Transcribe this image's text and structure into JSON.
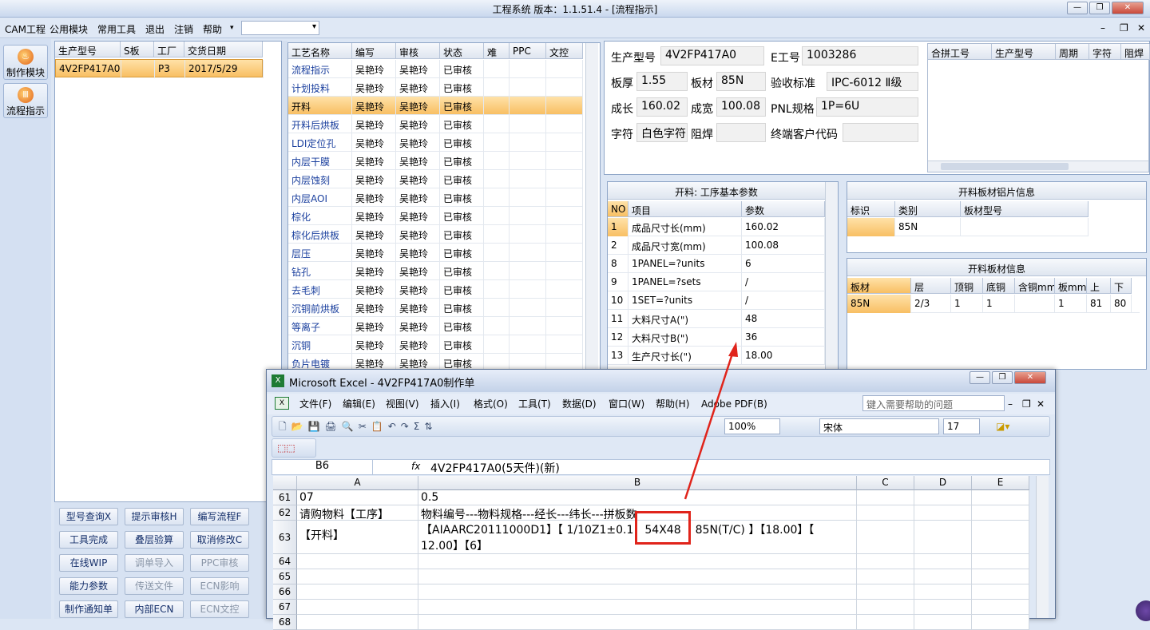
{
  "app": {
    "title": "工程系统   版本：1.1.51.4 - [流程指示]"
  },
  "menu": [
    "CAM工程",
    "公用模块",
    "常用工具",
    "退出",
    "注销",
    "帮助"
  ],
  "leftnav": [
    "制作模块",
    "流程指示"
  ],
  "orders": {
    "headers": [
      "生产型号",
      "S板",
      "工厂",
      "交货日期"
    ],
    "rows": [
      [
        "4V2FP417A0",
        "",
        "P3",
        "2017/5/29"
      ]
    ]
  },
  "process": {
    "headers": [
      "工艺名称",
      "编写",
      "审核",
      "状态",
      "难",
      "PPC",
      "文控"
    ],
    "rows": [
      [
        "流程指示",
        "吴艳玲",
        "吴艳玲",
        "已审核"
      ],
      [
        "计划投料",
        "吴艳玲",
        "吴艳玲",
        "已审核"
      ],
      [
        "开料",
        "吴艳玲",
        "吴艳玲",
        "已审核"
      ],
      [
        "开料后烘板",
        "吴艳玲",
        "吴艳玲",
        "已审核"
      ],
      [
        "LDI定位孔",
        "吴艳玲",
        "吴艳玲",
        "已审核"
      ],
      [
        "内层干膜",
        "吴艳玲",
        "吴艳玲",
        "已审核"
      ],
      [
        "内层蚀刻",
        "吴艳玲",
        "吴艳玲",
        "已审核"
      ],
      [
        "内层AOI",
        "吴艳玲",
        "吴艳玲",
        "已审核"
      ],
      [
        "棕化",
        "吴艳玲",
        "吴艳玲",
        "已审核"
      ],
      [
        "棕化后烘板",
        "吴艳玲",
        "吴艳玲",
        "已审核"
      ],
      [
        "层压",
        "吴艳玲",
        "吴艳玲",
        "已审核"
      ],
      [
        "钻孔",
        "吴艳玲",
        "吴艳玲",
        "已审核"
      ],
      [
        "去毛刺",
        "吴艳玲",
        "吴艳玲",
        "已审核"
      ],
      [
        "沉铜前烘板",
        "吴艳玲",
        "吴艳玲",
        "已审核"
      ],
      [
        "等离子",
        "吴艳玲",
        "吴艳玲",
        "已审核"
      ],
      [
        "沉铜",
        "吴艳玲",
        "吴艳玲",
        "已审核"
      ],
      [
        "负片电镀",
        "吴艳玲",
        "吴艳玲",
        "已审核"
      ]
    ]
  },
  "buttons": [
    [
      "型号查询X",
      "提示审核H",
      "编写流程F"
    ],
    [
      "工具完成",
      "叠层验算",
      "取消修改C"
    ],
    [
      "在线WIP",
      "调单导入",
      "PPC审核"
    ],
    [
      "能力参数",
      "传送文件",
      "ECN影响"
    ],
    [
      "制作通知单",
      "内部ECN",
      "ECN文控"
    ]
  ],
  "info": {
    "l1": "生产型号",
    "v1": "4V2FP417A0",
    "l2": "E工号",
    "v2": "1003286",
    "l3": "板厚",
    "v3": "1.55",
    "l4": "板材",
    "v4": "85N",
    "l5": "验收标准",
    "v5": "IPC-6012 Ⅱ级",
    "l6": "成长",
    "v6": "160.02",
    "l7": "成宽",
    "v7": "100.08",
    "l8": "PNL规格",
    "v8": "1P=6U",
    "l9": "字符",
    "v9": "白色字符",
    "l10": "阻焊",
    "v10": "",
    "l11": "终端客户代码",
    "v11": ""
  },
  "combine": {
    "headers": [
      "合拼工号",
      "生产型号",
      "周期",
      "字符",
      "阻焊"
    ]
  },
  "params": {
    "title": "开料: 工序基本参数",
    "headers": [
      "NO",
      "项目",
      "参数"
    ],
    "rows": [
      [
        "1",
        "成品尺寸长(mm)",
        "160.02"
      ],
      [
        "2",
        "成品尺寸宽(mm)",
        "100.08"
      ],
      [
        "8",
        "1PANEL=?units",
        "6"
      ],
      [
        "9",
        "1PANEL=?sets",
        "/"
      ],
      [
        "10",
        "1SET=?units",
        "/"
      ],
      [
        "11",
        "大料尺寸A(\")",
        "48"
      ],
      [
        "12",
        "大料尺寸B(\")",
        "36"
      ],
      [
        "13",
        "生产尺寸长(\")",
        "18.00"
      ]
    ]
  },
  "sheet": {
    "title": "开料板材铝片信息",
    "headers": [
      "标识",
      "类别",
      "板材型号"
    ],
    "rows": [
      [
        "",
        "85N",
        ""
      ]
    ]
  },
  "board": {
    "title": "开料板材信息",
    "headers": [
      "板材",
      "层",
      "顶铜",
      "底铜",
      "含铜mm",
      "板mm",
      "上",
      "下"
    ],
    "rows": [
      [
        "85N",
        "2/3",
        "1",
        "1",
        "",
        "1",
        "81",
        "80"
      ]
    ]
  },
  "excel": {
    "title": "Microsoft Excel - 4V2FP417A0制作单",
    "menu": [
      "文件(F)",
      "编辑(E)",
      "视图(V)",
      "插入(I)",
      "格式(O)",
      "工具(T)",
      "数据(D)",
      "窗口(W)",
      "帮助(H)",
      "Adobe PDF(B)"
    ],
    "help_placeholder": "键入需要帮助的问题",
    "zoom": "100%",
    "font": "宋体",
    "size": "17",
    "namebox": "B6",
    "formula": "4V2FP417A0(5天件)(新)",
    "cols": [
      "A",
      "B",
      "C",
      "D",
      "E"
    ],
    "rows": [
      {
        "n": "61",
        "a": "07",
        "b": "0.5"
      },
      {
        "n": "62",
        "a": "请购物料【工序】",
        "b": "物料编号---物料规格---经长---纬长---拼板数"
      },
      {
        "n": "63",
        "a": "【开料】",
        "b1": "【AIAARC20111000D1】【 1/10Z1±0.1",
        "b2": "54X48",
        "b3": "85N(T/C) 】【18.00】【",
        "b4": "12.00】【6】"
      },
      {
        "n": "64",
        "a": "",
        "b": ""
      },
      {
        "n": "65",
        "a": "",
        "b": ""
      },
      {
        "n": "66",
        "a": "",
        "b": ""
      },
      {
        "n": "67",
        "a": "",
        "b": ""
      },
      {
        "n": "68",
        "a": "",
        "b": ""
      }
    ]
  },
  "colors": {
    "highlight": "#f8bf63",
    "annotation": "#e0241b"
  }
}
